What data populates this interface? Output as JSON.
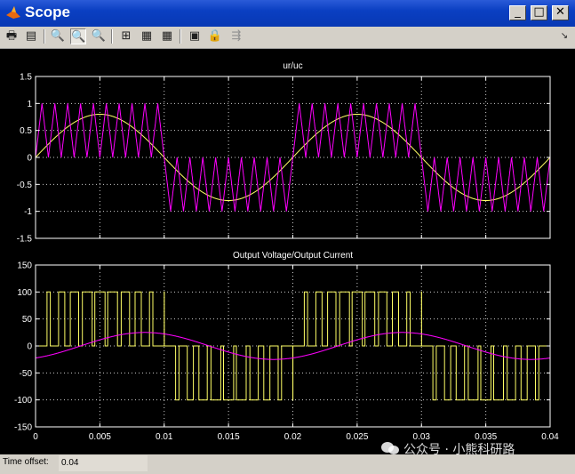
{
  "window": {
    "title": "Scope",
    "minimize_glyph": "_",
    "maximize_glyph": "□",
    "close_glyph": "✕"
  },
  "toolbar": {
    "buttons": [
      {
        "name": "print-icon",
        "glyph": "🖶"
      },
      {
        "name": "parameters-icon",
        "glyph": "▤"
      },
      {
        "name": "zoom-icon",
        "glyph": "🔍"
      },
      {
        "name": "zoom-x-icon",
        "glyph": "🔍"
      },
      {
        "name": "zoom-y-icon",
        "glyph": "🔍"
      },
      {
        "name": "autoscale-icon",
        "glyph": "⊞"
      },
      {
        "name": "save-axes-icon",
        "glyph": "▦"
      },
      {
        "name": "restore-axes-icon",
        "glyph": "▦"
      },
      {
        "name": "floating-scope-icon",
        "glyph": "▣"
      },
      {
        "name": "lock-icon",
        "glyph": "🔒"
      },
      {
        "name": "signal-selection-icon",
        "glyph": "⇶"
      }
    ],
    "dock_glyph": "↘"
  },
  "status": {
    "label": "Time offset:",
    "value": "0.04"
  },
  "watermark": {
    "text": "公众号 · 小熊科研路"
  },
  "colors": {
    "background": "#000000",
    "axis": "#ffffff",
    "grid": "#ffffff",
    "yellow": "#ffff66",
    "magenta": "#ff00ff",
    "title_bar": "#0a3fc2"
  },
  "chart_data": [
    {
      "type": "line",
      "title": "ur/uc",
      "xlim": [
        0,
        0.04
      ],
      "ylim": [
        -1.5,
        1.5
      ],
      "x_ticks": [
        "",
        "",
        "",
        "",
        "",
        "",
        "",
        "",
        ""
      ],
      "y_ticks": [
        "1.5",
        "1",
        "0.5",
        "0",
        "-0.5",
        "-1",
        "-1.5"
      ],
      "grid": true,
      "series": [
        {
          "color": "#ffff66",
          "kind": "sine",
          "amplitude": 0.8,
          "frequency_hz": 50
        },
        {
          "color": "#ff00ff",
          "kind": "unipolar-triangle-carrier",
          "amplitude": 1,
          "carrier_periods_per_half_cycle": 10
        }
      ]
    },
    {
      "type": "line",
      "title": "Output Voltage/Output Current",
      "xlim": [
        0,
        0.04
      ],
      "ylim": [
        -150,
        150
      ],
      "x_ticks": [
        "0",
        "0.005",
        "0.01",
        "0.015",
        "0.02",
        "0.025",
        "0.03",
        "0.035",
        "0.04"
      ],
      "y_ticks": [
        "150",
        "100",
        "50",
        "0",
        "-50",
        "-100",
        "-150"
      ],
      "grid": true,
      "series": [
        {
          "color": "#ffff66",
          "kind": "unipolar-pwm-voltage",
          "level": 100
        },
        {
          "color": "#ff00ff",
          "kind": "sine",
          "amplitude": 25,
          "frequency_hz": 50,
          "phase_lag_s": 0.0035
        }
      ]
    }
  ]
}
